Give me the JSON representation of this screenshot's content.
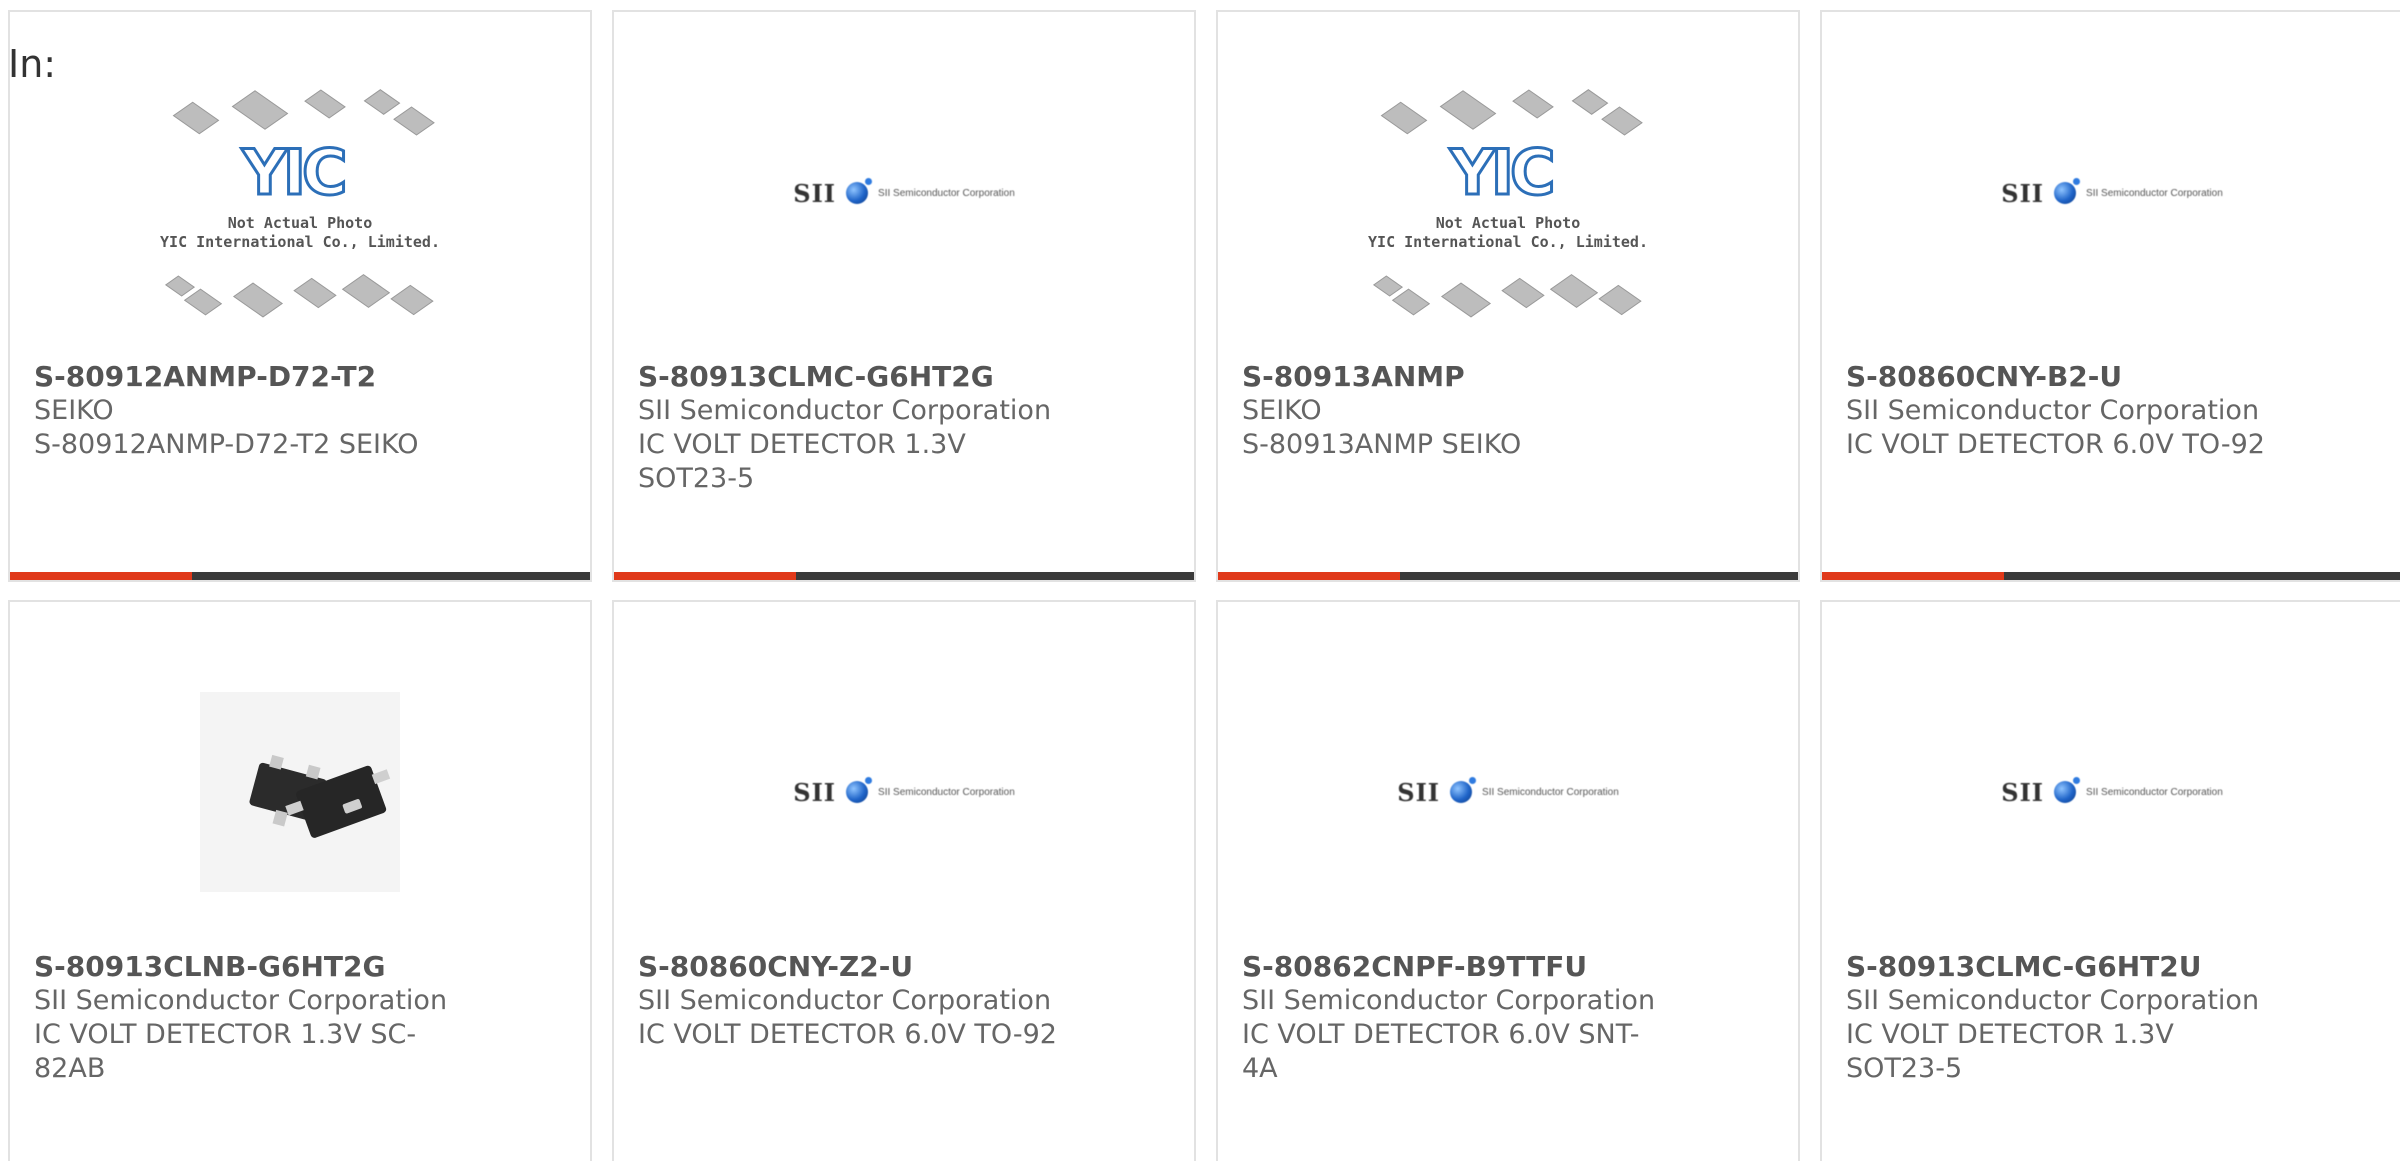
{
  "heading": "In:",
  "colors": {
    "accent": "#e0391a",
    "bar": "#3a3a3a",
    "border": "#e2e2e2",
    "text": "#666666"
  },
  "logo": {
    "sii_text": "SII",
    "sii_sub": "SII Semiconductor Corporation",
    "yic_letters": "YIC",
    "yic_caption_line1": "Not Actual Photo",
    "yic_caption_line2": "YIC International Co., Limited."
  },
  "products": [
    {
      "part": "S-80912ANMP-D72-T2",
      "manufacturer": "SEIKO",
      "description": "S-80912ANMP-D72-T2 SEIKO",
      "image": "yic-placeholder"
    },
    {
      "part": "S-80913CLMC-G6HT2G",
      "manufacturer": "SII Semiconductor Corporation",
      "description": "IC VOLT DETECTOR 1.3V SOT23-5",
      "image": "sii-logo"
    },
    {
      "part": "S-80913ANMP",
      "manufacturer": "SEIKO",
      "description": "S-80913ANMP SEIKO",
      "image": "yic-placeholder"
    },
    {
      "part": "S-80860CNY-B2-U",
      "manufacturer": "SII Semiconductor Corporation",
      "description": "IC VOLT DETECTOR 6.0V TO-92",
      "image": "sii-logo"
    },
    {
      "part": "S-80913CLNB-G6HT2G",
      "manufacturer": "SII Semiconductor Corporation",
      "description": "IC VOLT DETECTOR 1.3V SC-82AB",
      "image": "product-photo"
    },
    {
      "part": "S-80860CNY-Z2-U",
      "manufacturer": "SII Semiconductor Corporation",
      "description": "IC VOLT DETECTOR 6.0V TO-92",
      "image": "sii-logo"
    },
    {
      "part": "S-80862CNPF-B9TTFU",
      "manufacturer": "SII Semiconductor Corporation",
      "description": "IC VOLT DETECTOR 6.0V SNT-4A",
      "image": "sii-logo"
    },
    {
      "part": "S-80913CLMC-G6HT2U",
      "manufacturer": "SII Semiconductor Corporation",
      "description": "IC VOLT DETECTOR 1.3V SOT23-5",
      "image": "sii-logo"
    }
  ]
}
